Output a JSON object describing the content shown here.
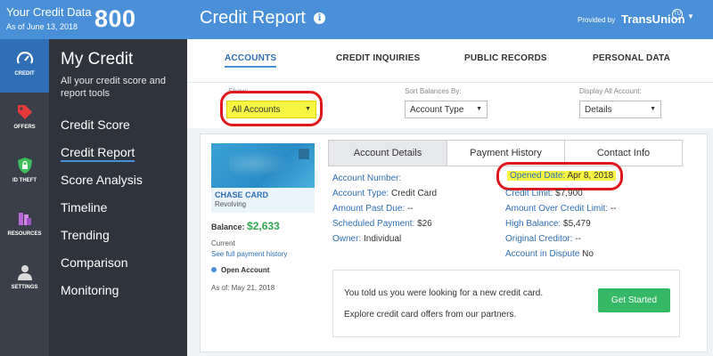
{
  "header": {
    "credit_data_label": "Your Credit Data",
    "as_of_date": "As of June 13, 2018",
    "score": "800",
    "page_title": "Credit Report",
    "provided_by": "Provided by",
    "provider": "TransUnion",
    "provider_mark": "TU",
    "info_icon": "i"
  },
  "rail": {
    "items": [
      {
        "label": "CREDIT",
        "icon": "gauge-icon"
      },
      {
        "label": "OFFERS",
        "icon": "tag-icon"
      },
      {
        "label": "ID THEFT",
        "icon": "shield-lock-icon"
      },
      {
        "label": "RESOURCES",
        "icon": "books-icon"
      },
      {
        "label": "SETTINGS",
        "icon": "person-icon"
      }
    ]
  },
  "sidenav": {
    "heading": "My Credit",
    "subtitle": "All your credit score and report tools",
    "items": [
      "Credit Score",
      "Credit Report",
      "Score Analysis",
      "Timeline",
      "Trending",
      "Comparison",
      "Monitoring"
    ],
    "active": "Credit Report"
  },
  "tabs": [
    "ACCOUNTS",
    "CREDIT INQUIRIES",
    "PUBLIC RECORDS",
    "PERSONAL DATA"
  ],
  "filters": {
    "show_label": "Show:",
    "show_value": "All Accounts",
    "sort_label": "Sort Balances By:",
    "sort_value": "Account Type",
    "display_label": "Display All Account:",
    "display_value": "Details"
  },
  "account": {
    "name": "CHASE CARD",
    "type": "Revolving",
    "balance_label": "Balance:",
    "balance_value": "$2,633",
    "status": "Current",
    "history_link": "See full payment history",
    "open_status": "Open Account",
    "as_of": "As of: May 21, 2018"
  },
  "detail_tabs": [
    "Account Details",
    "Payment History",
    "Contact Info"
  ],
  "details_left": [
    {
      "k": "Account Number:",
      "v": ""
    },
    {
      "k": "Account Type:",
      "v": "Credit Card"
    },
    {
      "k": "Amount Past Due:",
      "v": "--"
    },
    {
      "k": "Scheduled Payment:",
      "v": "$26"
    },
    {
      "k": "Owner:",
      "v": "Individual"
    }
  ],
  "details_right": [
    {
      "k": "Opened Date:",
      "v": "Apr 8, 2018"
    },
    {
      "k": "Credit Limit:",
      "v": "$7,900"
    },
    {
      "k": "Amount Over Credit Limit:",
      "v": "--"
    },
    {
      "k": "High Balance:",
      "v": "$5,479"
    },
    {
      "k": "Original Creditor:",
      "v": "--"
    },
    {
      "k": "Account in Dispute",
      "v": "No"
    }
  ],
  "offer": {
    "line1": "You told us you were looking for a new credit card.",
    "line2": "Explore credit card offers from our partners.",
    "button": "Get Started"
  },
  "colors": {
    "header_blue": "#4a90d9",
    "highlight_yellow": "#f6f542",
    "annotation_red": "#e0181e",
    "cta_green": "#35b866"
  }
}
